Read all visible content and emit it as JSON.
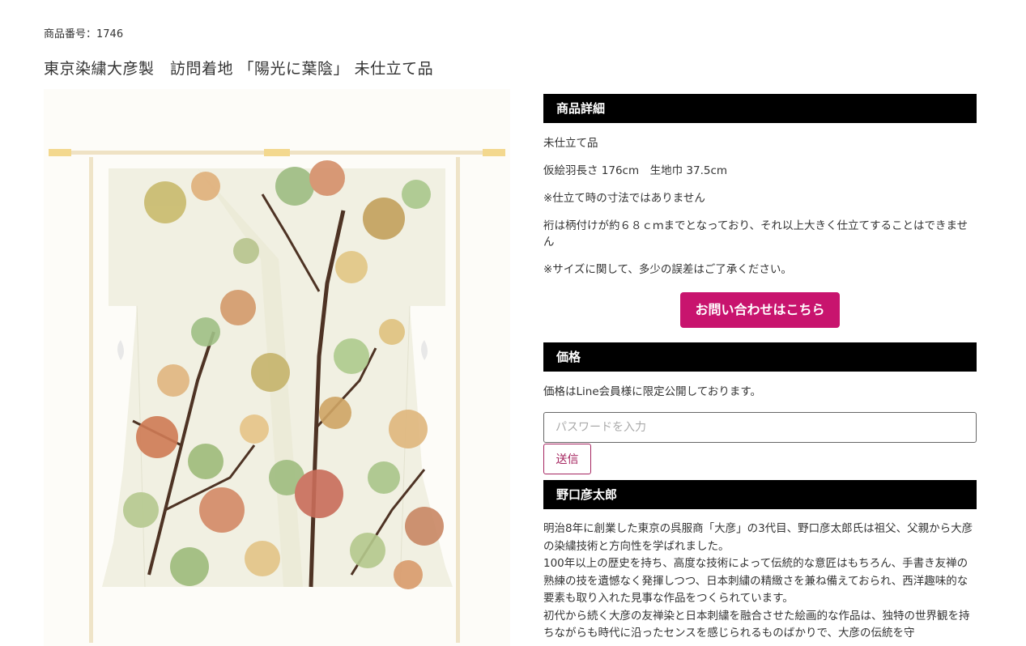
{
  "product": {
    "number_label": "商品番号：1746",
    "title": "東京染繍大彦製　訪問着地 「陽光に葉陰」 未仕立て品"
  },
  "image": {
    "alt": "kimono-with-maple-leaves"
  },
  "details": {
    "heading": "商品詳細",
    "lines": [
      "未仕立て品",
      "仮絵羽長さ 176cm　生地巾 37.5cm",
      "※仕立て時の寸法ではありません",
      "裄は柄付けが約６８ｃｍまでとなっており、それ以上大きく仕立てすることはできません",
      "※サイズに関して、多少の誤差はご了承ください。"
    ],
    "contact_button": "お問い合わせはこちら"
  },
  "price": {
    "heading": "価格",
    "note": "価格はLine会員様に限定公開しております。",
    "password_placeholder": "パスワードを入力",
    "submit_label": "送信"
  },
  "artist": {
    "heading": "野口彦太郎",
    "paragraphs": [
      "明治8年に創業した東京の呉服商「大彦」の3代目、野口彦太郎氏は祖父、父親から大彦の染繍技術と方向性を学ばれました。",
      "100年以上の歴史を持ち、高度な技術によって伝統的な意匠はもちろん、手書き友禅の熟練の技を遺憾なく発揮しつつ、日本刺繍の精緻さを兼ね備えておられ、西洋趣味的な要素も取り入れた見事な作品をつくられています。",
      "初代から続く大彦の友禅染と日本刺繍を融合させた絵画的な作品は、独特の世界観を持ちながらも時代に沿ったセンスを感じられるものばかりで、大彦の伝統を守"
    ]
  },
  "colors": {
    "section_bg": "#000000",
    "accent": "#c8146e",
    "send_border": "#a5245f",
    "kimono_base": "#f2f1e3"
  }
}
